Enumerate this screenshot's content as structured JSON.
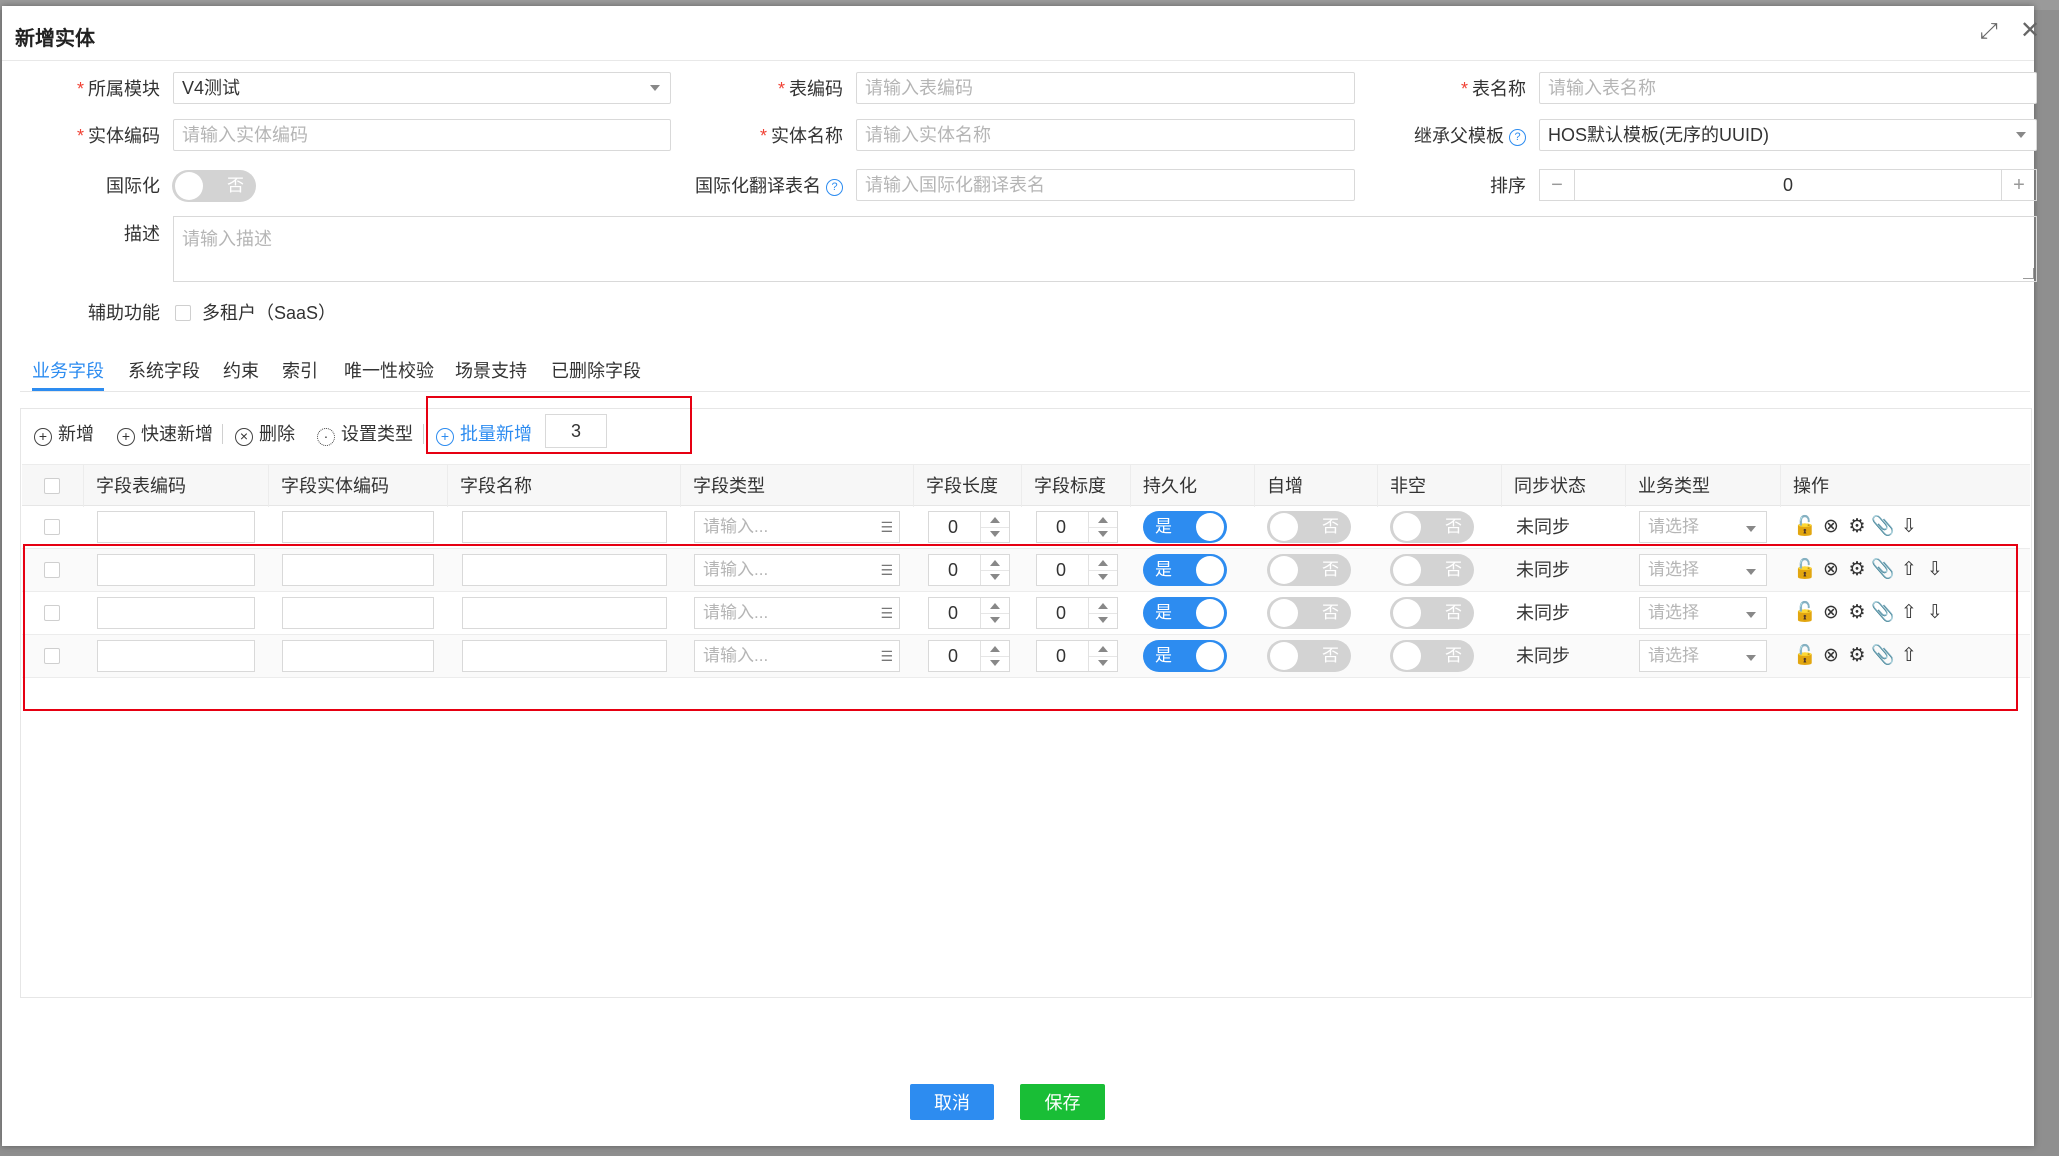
{
  "dialog": {
    "title": "新增实体"
  },
  "form": {
    "module_label": "所属模块",
    "module_value": "V4测试",
    "table_code_label": "表编码",
    "table_code_placeholder": "请输入表编码",
    "table_name_label": "表名称",
    "table_name_placeholder": "请输入表名称",
    "entity_code_label": "实体编码",
    "entity_code_placeholder": "请输入实体编码",
    "entity_name_label": "实体名称",
    "entity_name_placeholder": "请输入实体名称",
    "parent_template_label": "继承父模板",
    "parent_template_value": "HOS默认模板(无序的UUID)",
    "i18n_label": "国际化",
    "i18n_toggle_text": "否",
    "i18n_table_label": "国际化翻译表名",
    "i18n_table_placeholder": "请输入国际化翻译表名",
    "sort_label": "排序",
    "sort_value": "0",
    "description_label": "描述",
    "description_placeholder": "请输入描述",
    "aux_label": "辅助功能",
    "multi_tenant_label": "多租户（SaaS）"
  },
  "tabs": [
    "业务字段",
    "系统字段",
    "约束",
    "索引",
    "唯一性校验",
    "场景支持",
    "已删除字段"
  ],
  "toolbar": {
    "add": "新增",
    "quick_add": "快速新增",
    "delete": "删除",
    "set_type": "设置类型",
    "batch_add": "批量新增",
    "batch_count": "3"
  },
  "table": {
    "columns": [
      "字段表编码",
      "字段实体编码",
      "字段名称",
      "字段类型",
      "字段长度",
      "字段标度",
      "持久化",
      "自增",
      "非空",
      "同步状态",
      "业务类型",
      "操作"
    ],
    "type_placeholder": "请输入...",
    "biz_placeholder": "请选择",
    "rows": [
      {
        "length": "0",
        "scale": "0",
        "persist": "是",
        "auto_inc": "否",
        "not_null": "否",
        "sync": "未同步"
      },
      {
        "length": "0",
        "scale": "0",
        "persist": "是",
        "auto_inc": "否",
        "not_null": "否",
        "sync": "未同步"
      },
      {
        "length": "0",
        "scale": "0",
        "persist": "是",
        "auto_inc": "否",
        "not_null": "否",
        "sync": "未同步"
      },
      {
        "length": "0",
        "scale": "0",
        "persist": "是",
        "auto_inc": "否",
        "not_null": "否",
        "sync": "未同步"
      }
    ]
  },
  "footer": {
    "cancel": "取消",
    "save": "保存"
  },
  "colors": {
    "primary": "#2d8cf0",
    "success": "#19be36",
    "danger_outline": "#e60012"
  }
}
